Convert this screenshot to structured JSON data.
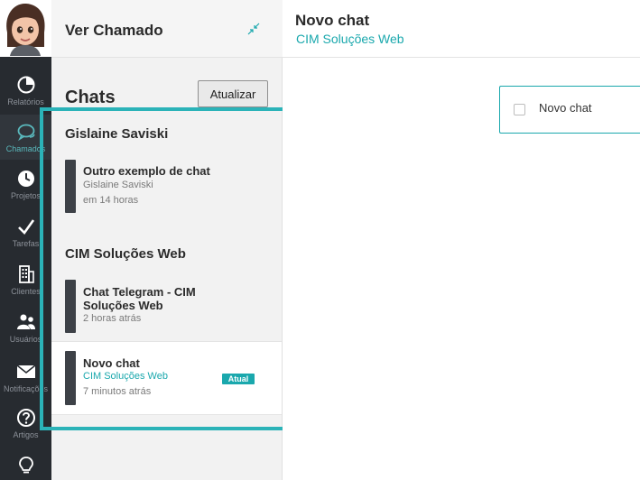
{
  "nav": {
    "items": [
      {
        "label": "Relatórios",
        "icon": "pie-chart-icon"
      },
      {
        "label": "Chamados",
        "icon": "chat-bubbles-icon",
        "active": true
      },
      {
        "label": "Projetos",
        "icon": "clock-icon"
      },
      {
        "label": "Tarefas",
        "icon": "checkmark-icon"
      },
      {
        "label": "Clientes",
        "icon": "building-icon"
      },
      {
        "label": "Usuários",
        "icon": "users-icon"
      },
      {
        "label": "Notificações",
        "icon": "envelope-icon"
      },
      {
        "label": "Artigos",
        "icon": "help-circle-icon"
      },
      {
        "label": "",
        "icon": "lightbulb-icon"
      }
    ],
    "avatar": "user-avatar"
  },
  "panel": {
    "title": "Ver Chamado",
    "collapse_icon": "collapse-arrows-icon"
  },
  "chats": {
    "title": "Chats",
    "refresh_label": "Atualizar",
    "groups": [
      {
        "title": "Gislaine Saviski",
        "items": [
          {
            "name": "Outro exemplo de chat",
            "subtitle": "Gislaine Saviski",
            "time": "em 14 horas"
          }
        ]
      },
      {
        "title": "CIM Soluções Web",
        "items": [
          {
            "name": "Chat Telegram - CIM Soluções Web",
            "subtitle": "",
            "time": "2 horas atrás"
          },
          {
            "name": "Novo chat",
            "subtitle": "CIM Soluções Web",
            "time": "7 minutos atrás",
            "badge": "Atual",
            "selected": true
          }
        ]
      }
    ]
  },
  "main": {
    "title": "Novo chat",
    "subtitle": "CIM Soluções Web",
    "card": {
      "label": "Novo chat"
    }
  },
  "colors": {
    "accent": "#1aa8ad",
    "highlight": "#2bb3b8",
    "rail_bg": "#272b30"
  }
}
